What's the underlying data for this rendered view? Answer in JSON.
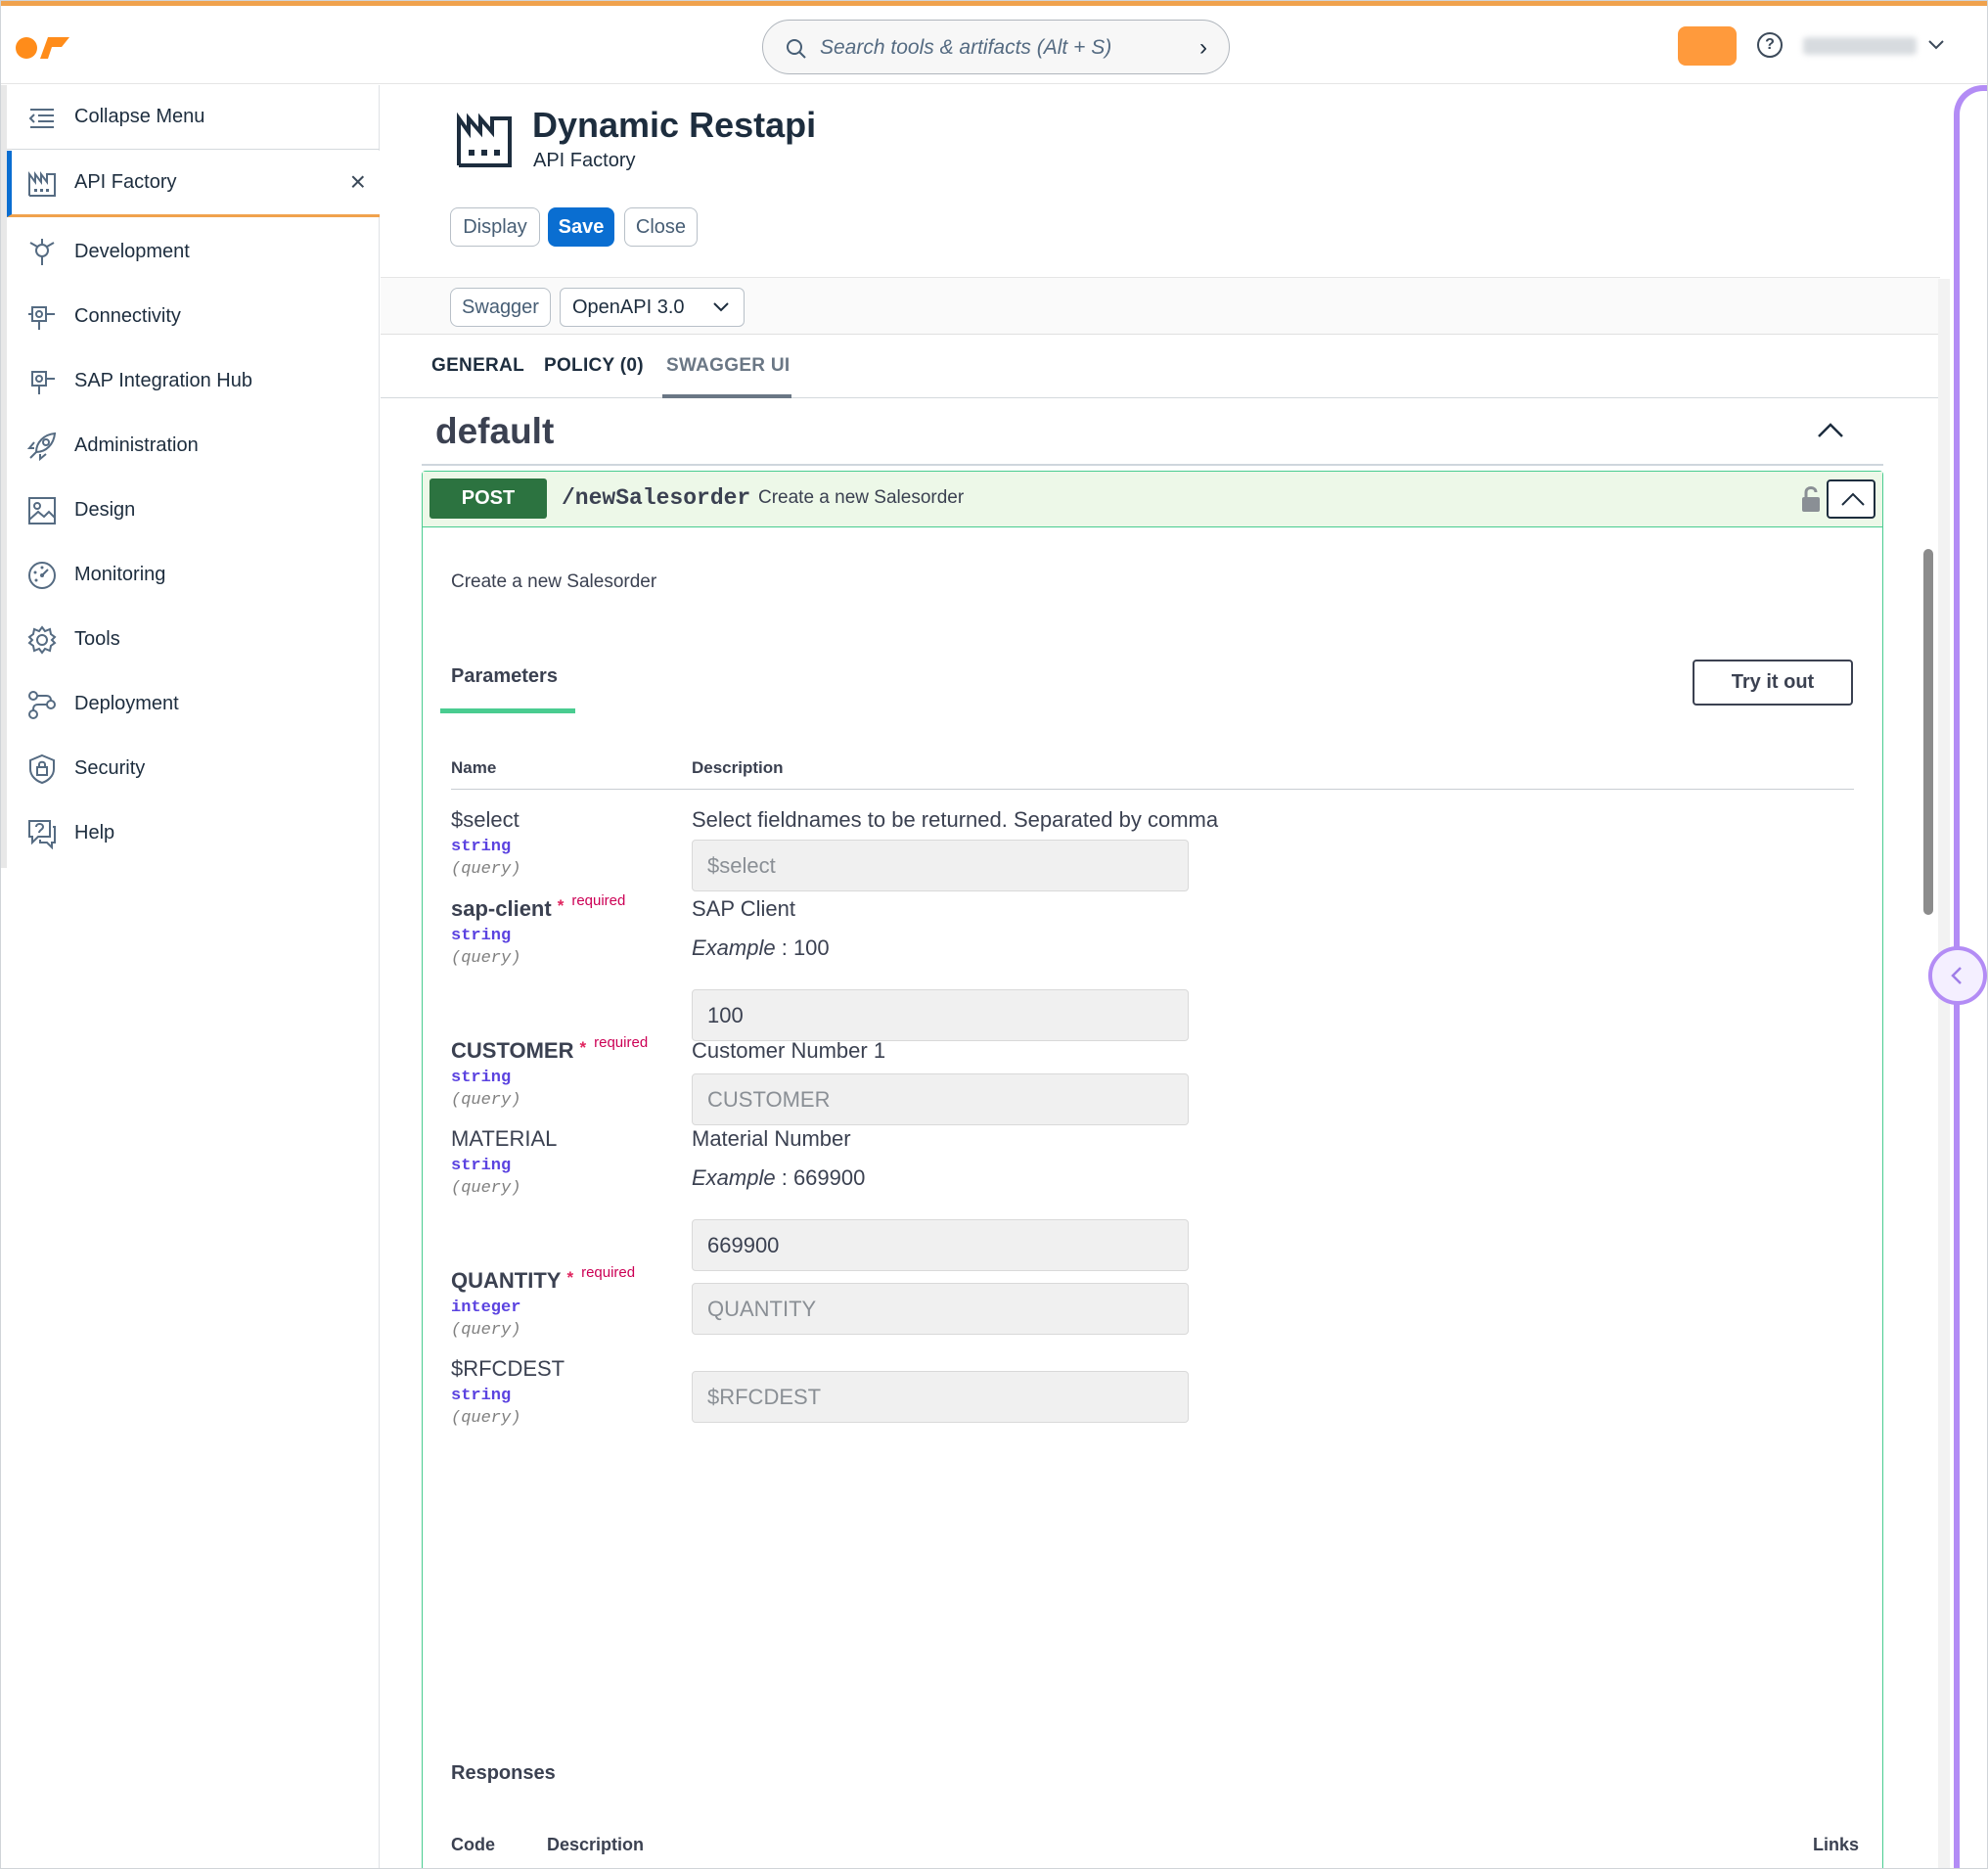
{
  "search": {
    "placeholder": "Search tools & artifacts (Alt + S)"
  },
  "sidebar": {
    "collapse_label": "Collapse Menu",
    "active_item": "API Factory",
    "items": [
      {
        "label": "Development",
        "icon": "development-icon"
      },
      {
        "label": "Connectivity",
        "icon": "connectivity-icon"
      },
      {
        "label": "SAP Integration Hub",
        "icon": "integration-hub-icon"
      },
      {
        "label": "Administration",
        "icon": "rocket-icon"
      },
      {
        "label": "Design",
        "icon": "image-icon"
      },
      {
        "label": "Monitoring",
        "icon": "dashboard-icon"
      },
      {
        "label": "Tools",
        "icon": "gear-icon"
      },
      {
        "label": "Deployment",
        "icon": "deployment-icon"
      },
      {
        "label": "Security",
        "icon": "shield-icon"
      },
      {
        "label": "Help",
        "icon": "question-bubble-icon"
      }
    ]
  },
  "header": {
    "title": "Dynamic Restapi",
    "subtitle": "API Factory",
    "buttons": {
      "display": "Display",
      "save": "Save",
      "close": "Close"
    },
    "swagger_button": "Swagger",
    "spec_select": "OpenAPI 3.0"
  },
  "tabs": [
    "GENERAL",
    "POLICY (0)",
    "SWAGGER UI"
  ],
  "swagger": {
    "section": "default",
    "operation": {
      "method": "POST",
      "path": "/newSalesorder",
      "summary": "Create a new Salesorder",
      "description": "Create a new Salesorder",
      "parameters_tab": "Parameters",
      "try_button": "Try it out",
      "col_name": "Name",
      "col_desc": "Description",
      "required_label": "required",
      "params": [
        {
          "name": "$select",
          "type": "string",
          "in": "(query)",
          "desc": "Select fieldnames to be returned. Separated by comma",
          "value": "$select"
        },
        {
          "name": "sap-client",
          "type": "string",
          "in": "(query)",
          "desc": "SAP Client",
          "example_label": "Example",
          "example": ": 100",
          "value": "100"
        },
        {
          "name": "CUSTOMER",
          "type": "string",
          "in": "(query)",
          "desc": "Customer Number 1",
          "value": "CUSTOMER"
        },
        {
          "name": "MATERIAL",
          "type": "string",
          "in": "(query)",
          "desc": "Material Number",
          "example_label": "Example",
          "example": ": 669900",
          "value": "669900"
        },
        {
          "name": "QUANTITY",
          "type": "integer",
          "in": "(query)",
          "value": "QUANTITY"
        },
        {
          "name": "$RFCDEST",
          "type": "string",
          "in": "(query)",
          "value": "$RFCDEST"
        }
      ],
      "responses_label": "Responses",
      "responses_cols": {
        "code": "Code",
        "desc": "Description",
        "links": "Links"
      }
    }
  },
  "colors": {
    "accent": "#0a6ed1",
    "post": "#2c7340",
    "post_border": "#49cc90",
    "brand": "#f0a24d",
    "side_panel": "#b38cf5"
  }
}
